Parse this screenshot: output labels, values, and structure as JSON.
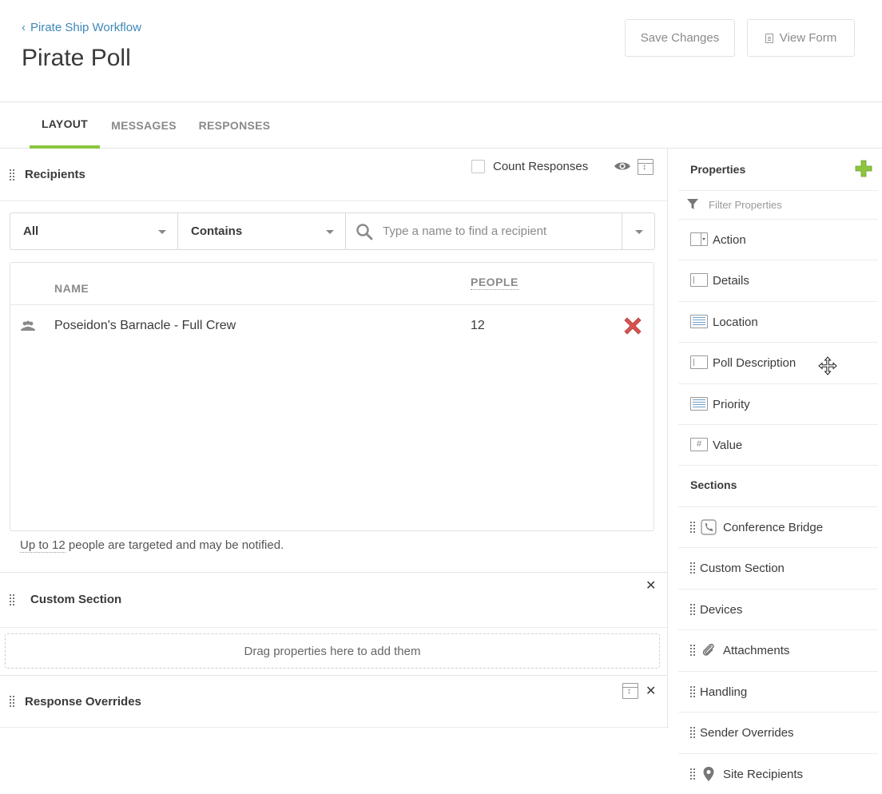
{
  "header": {
    "breadcrumb": "Pirate Ship Workflow",
    "title": "Pirate Poll",
    "save_label": "Save Changes",
    "view_label": "View Form"
  },
  "tabs": [
    {
      "label": "LAYOUT",
      "active": true
    },
    {
      "label": "MESSAGES",
      "active": false
    },
    {
      "label": "RESPONSES",
      "active": false
    }
  ],
  "recipients": {
    "title": "Recipients",
    "count_label": "Count Responses",
    "filter_scope": "All",
    "filter_mode": "Contains",
    "search_placeholder": "Type a name to find a recipient",
    "columns": {
      "name": "NAME",
      "people": "PEOPLE"
    },
    "rows": [
      {
        "name": "Poseidon's Barnacle - Full Crew",
        "people": "12"
      }
    ],
    "targeted_prefix": "Up to 12",
    "targeted_suffix": " people are targeted and may be notified."
  },
  "custom_section": {
    "title": "Custom Section",
    "dropzone": "Drag properties here to add them"
  },
  "response_overrides": {
    "title": "Response Overrides"
  },
  "sidebar": {
    "title": "Properties",
    "filter_placeholder": "Filter Properties",
    "properties": [
      {
        "label": "Action",
        "icon": "select-field-icon"
      },
      {
        "label": "Details",
        "icon": "text-field-icon"
      },
      {
        "label": "Location",
        "icon": "text-area-icon"
      },
      {
        "label": "Poll Description",
        "icon": "text-field-icon"
      },
      {
        "label": "Priority",
        "icon": "text-area-icon"
      },
      {
        "label": "Value",
        "icon": "number-field-icon"
      }
    ],
    "sections_title": "Sections",
    "sections": [
      {
        "label": "Conference Bridge",
        "icon": "phone-icon"
      },
      {
        "label": "Custom Section",
        "icon": ""
      },
      {
        "label": "Devices",
        "icon": ""
      },
      {
        "label": "Attachments",
        "icon": "paperclip-icon"
      },
      {
        "label": "Handling",
        "icon": ""
      },
      {
        "label": "Sender Overrides",
        "icon": ""
      },
      {
        "label": "Site Recipients",
        "icon": "map-pin-icon"
      }
    ]
  },
  "colors": {
    "accent": "#8cc63f",
    "link": "#3f88b8",
    "remove": "#d9534f"
  }
}
